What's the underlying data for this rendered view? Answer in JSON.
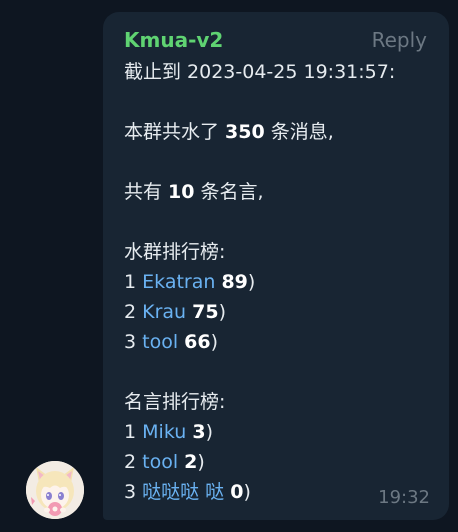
{
  "message": {
    "author": "Kmua-v2",
    "reply_label": "Reply",
    "time": "19:32",
    "header_line": "截止到 2023-04-25 19:31:57:",
    "total": {
      "prefix": "本群共水了 ",
      "count": "350",
      "suffix": " 条消息,"
    },
    "quotes": {
      "prefix": "共有 ",
      "count": "10",
      "suffix": " 条名言,"
    },
    "water_ranking": {
      "title": "水群排行榜:",
      "entries": [
        {
          "rank": "1",
          "name": "Ekatran",
          "count": "89"
        },
        {
          "rank": "2",
          "name": "Krau",
          "count": "75"
        },
        {
          "rank": "3",
          "name": "tool",
          "count": "66"
        }
      ]
    },
    "quote_ranking": {
      "title": "名言排行榜:",
      "entries": [
        {
          "rank": "1",
          "name": "Miku",
          "count": "3"
        },
        {
          "rank": "2",
          "name": "tool",
          "count": "2"
        },
        {
          "rank": "3",
          "name": "哒哒哒 哒",
          "count": "0"
        }
      ]
    }
  },
  "colors": {
    "background": "#0e1621",
    "bubble": "#182533",
    "author": "#5fd372",
    "link": "#6ab2f2",
    "muted": "#6c7883",
    "text": "#e6ebef"
  },
  "icons": {
    "avatar": "anime-girl-avatar"
  }
}
